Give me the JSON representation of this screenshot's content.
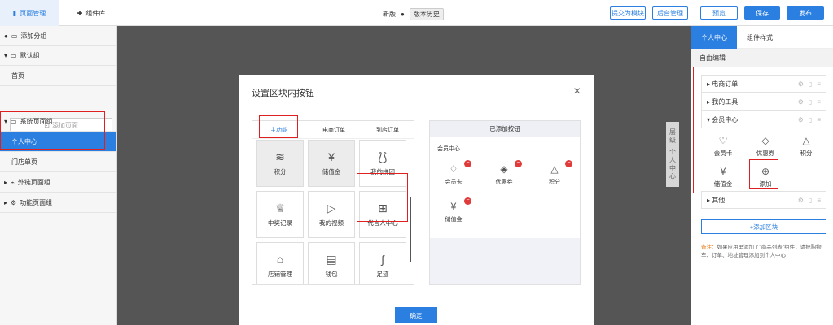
{
  "topbar": {
    "tab_page_mgmt": "页面管理",
    "tab_components": "组件库",
    "version_label": "新版",
    "history_label": "版本历史",
    "btn_submit_module": "提交为模块",
    "btn_backend": "后台管理",
    "btn_preview": "预览",
    "btn_save": "保存",
    "btn_publish": "发布",
    "accent": "#2b7fe0"
  },
  "sidebar": {
    "add_group": "添加分组",
    "default_group": "默认组",
    "home": "首页",
    "add_page": "添加页面",
    "system_group": "系统页面组",
    "personal_center": "个人中心",
    "store_page": "门店单页",
    "external_group": "外链页面组",
    "function_group": "功能页面组"
  },
  "canvas": {
    "side_tab": "层级 个人中心"
  },
  "modal": {
    "title": "设置区块内按钮",
    "close": "×",
    "tabs": [
      "主功能",
      "电商订单",
      "到店订单"
    ],
    "tiles": [
      {
        "icon": "points-icon",
        "glyph": "≋",
        "label": "积分"
      },
      {
        "icon": "stored-value-icon",
        "glyph": "¥",
        "label": "储值金"
      },
      {
        "icon": "group-buy-icon",
        "glyph": "⟅⟆",
        "label": "我的拼团"
      },
      {
        "icon": "trophy-icon",
        "glyph": "♕",
        "label": "中奖记录"
      },
      {
        "icon": "video-icon",
        "glyph": "▷",
        "label": "我的视频"
      },
      {
        "icon": "org-chart-icon",
        "glyph": "⊞",
        "label": "代言人中心"
      },
      {
        "icon": "store-icon",
        "glyph": "⌂",
        "label": "店铺管理"
      },
      {
        "icon": "wallet-icon",
        "glyph": "▤",
        "label": "钱包"
      },
      {
        "icon": "footprint-icon",
        "glyph": "ʃ",
        "label": "足迹"
      }
    ],
    "added_header": "已添加按钮",
    "added_section": "会员中心",
    "added": [
      {
        "icon": "member-card-icon",
        "glyph": "♢",
        "label": "会员卡"
      },
      {
        "icon": "coupon-icon",
        "glyph": "◈",
        "label": "优惠券"
      },
      {
        "icon": "points-icon",
        "glyph": "△",
        "label": "积分"
      },
      {
        "icon": "stored-value-icon",
        "glyph": "¥",
        "label": "储值金"
      }
    ],
    "remove_glyph": "−",
    "confirm": "确定"
  },
  "right": {
    "tab_personal": "个人中心",
    "tab_style": "组件样式",
    "free_edit": "自由编辑",
    "groups": [
      "电商订单",
      "我的工具",
      "会员中心",
      "其他"
    ],
    "member_tiles": [
      {
        "icon": "member-card-icon",
        "glyph": "♡",
        "label": "会员卡"
      },
      {
        "icon": "coupon-icon",
        "glyph": "◇",
        "label": "优惠券"
      },
      {
        "icon": "points-icon",
        "glyph": "△",
        "label": "积分"
      },
      {
        "icon": "stored-value-icon",
        "glyph": "¥",
        "label": "储值金"
      },
      {
        "icon": "add-icon",
        "glyph": "⊕",
        "label": "添加"
      }
    ],
    "add_block": "+添加区块",
    "note_label": "备注：",
    "note_text": "如果应用里添加了\"商品列表\"组件，请把购物车、订单、地址管理添加到个人中心"
  }
}
